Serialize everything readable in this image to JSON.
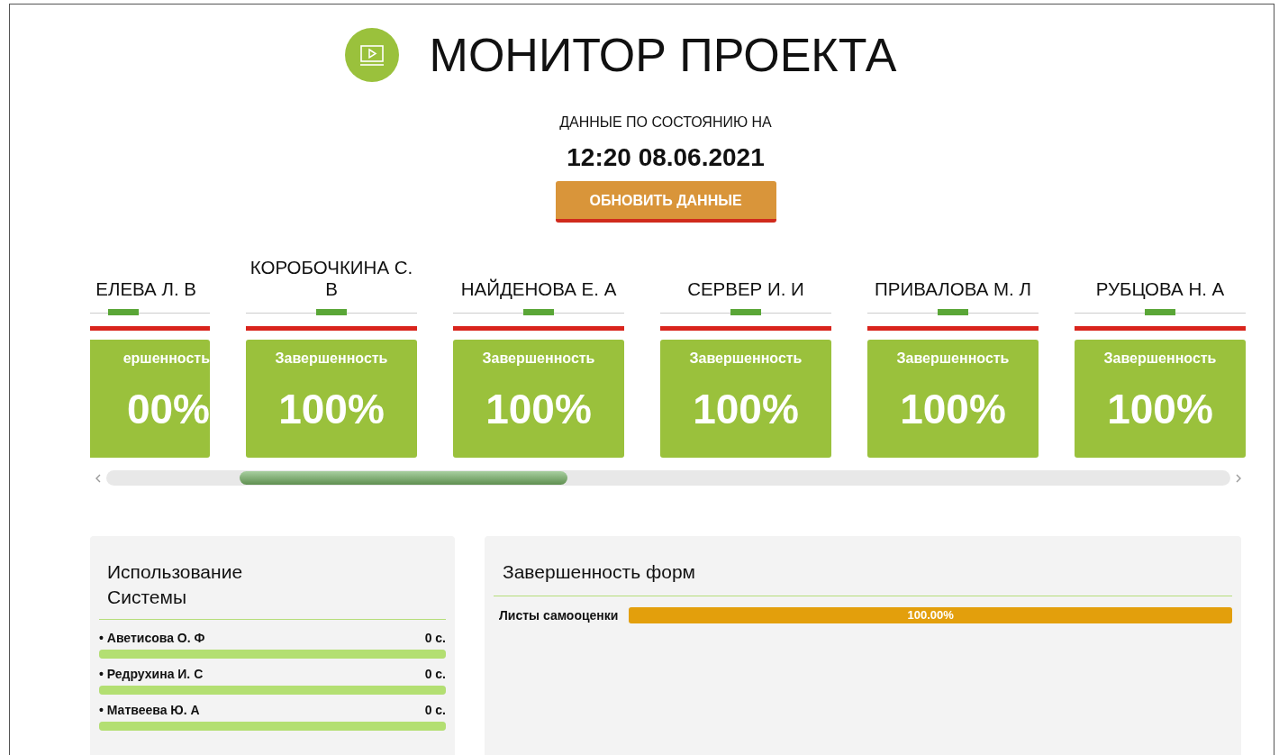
{
  "header": {
    "title": "МОНИТОР ПРОЕКТА",
    "subtitle": "ДАННЫЕ ПО СОСТОЯНИЮ НА",
    "timestamp": "12:20 08.06.2021",
    "refresh_button": "ОБНОВИТЬ ДАННЫЕ"
  },
  "people": [
    {
      "kind": "cut",
      "name": "ЕЛЕВА Л. В",
      "metric": "ершенность",
      "value": "00%"
    },
    {
      "kind": "full",
      "name": "КОРОБОЧКИНА С. В",
      "metric": "Завершенность",
      "value": "100%"
    },
    {
      "kind": "full",
      "name": "НАЙДЕНОВА Е. А",
      "metric": "Завершенность",
      "value": "100%"
    },
    {
      "kind": "full",
      "name": "СЕРВЕР И. И",
      "metric": "Завершенность",
      "value": "100%"
    },
    {
      "kind": "full",
      "name": "ПРИВАЛОВА М. Л",
      "metric": "Завершенность",
      "value": "100%"
    },
    {
      "kind": "full",
      "name": "РУБЦОВА Н. А",
      "metric": "Завершенность",
      "value": "100%"
    }
  ],
  "usage": {
    "title": "Использование Системы",
    "rows": [
      {
        "name": "• Аветисова О. Ф",
        "time": "0 с.",
        "level": 1
      },
      {
        "name": "• Редрухина И. С",
        "time": "0 с.",
        "level": 1
      },
      {
        "name": "• Матвеева Ю. А",
        "time": "0 с.",
        "level": 1
      }
    ]
  },
  "forms": {
    "title": "Завершенность форм",
    "rows": [
      {
        "label": "Листы самооценки",
        "value": "100.00%",
        "level": 1
      }
    ]
  }
}
